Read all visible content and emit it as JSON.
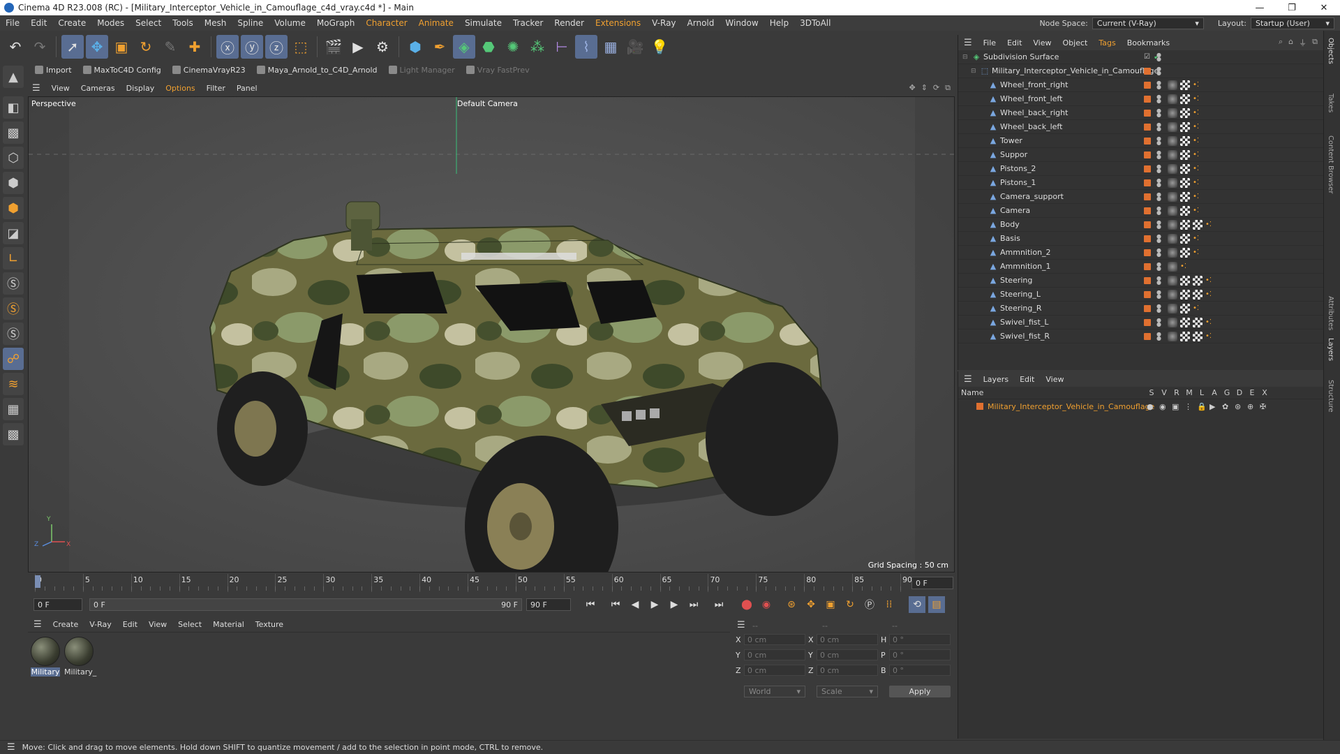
{
  "window": {
    "title": "Cinema 4D R23.008 (RC) - [Military_Interceptor_Vehicle_in_Camouflage_c4d_vray.c4d *] - Main",
    "minimize": "—",
    "restore": "❐",
    "close": "✕"
  },
  "menu": [
    "File",
    "Edit",
    "Create",
    "Modes",
    "Select",
    "Tools",
    "Mesh",
    "Spline",
    "Volume",
    "MoGraph",
    "Character",
    "Animate",
    "Simulate",
    "Tracker",
    "Render",
    "Extensions",
    "V-Ray",
    "Arnold",
    "Window",
    "Help",
    "3DToAll"
  ],
  "menu_highlight": [
    "Character",
    "Animate",
    "Extensions"
  ],
  "node_space": {
    "label": "Node Space:",
    "value": "Current (V-Ray)"
  },
  "layout": {
    "label": "Layout:",
    "value": "Startup (User)"
  },
  "toolbar_icons": [
    "undo-icon",
    "redo-icon",
    "live-select-icon",
    "move-icon",
    "scale-icon",
    "rotate-icon",
    "recent-icon",
    "create-icon",
    "x-axis-icon",
    "y-axis-icon",
    "z-axis-icon",
    "coord-system-icon",
    "render-view-icon",
    "render-picture-viewer-icon",
    "render-settings-icon",
    "cube-icon",
    "pen-icon",
    "subdivision-icon",
    "extrude-icon",
    "cloner-icon",
    "array-icon",
    "deformer-icon",
    "spline-icon",
    "floor-icon",
    "camera-icon",
    "light-icon"
  ],
  "plugins": [
    {
      "label": "Import",
      "dim": false
    },
    {
      "label": "MaxToC4D Config",
      "dim": false
    },
    {
      "label": "CinemaVrayR23",
      "dim": false
    },
    {
      "label": "Maya_Arnold_to_C4D_Arnold",
      "dim": false
    },
    {
      "label": "Light Manager",
      "dim": true
    },
    {
      "label": "Vray FastPrev",
      "dim": true
    }
  ],
  "viewport": {
    "menu": [
      "View",
      "Cameras",
      "Display",
      "Options",
      "Filter",
      "Panel"
    ],
    "menu_highlight": "Options",
    "name": "Perspective",
    "camera": "Default Camera",
    "grid_spacing": "Grid Spacing : 50 cm",
    "axis": {
      "y": "Y",
      "z": "Z",
      "x": "X"
    }
  },
  "timeline": {
    "ticks": [
      "0",
      "5",
      "10",
      "15",
      "20",
      "25",
      "30",
      "35",
      "40",
      "45",
      "50",
      "55",
      "60",
      "65",
      "70",
      "75",
      "80",
      "85",
      "90"
    ],
    "current_frame": "0 F"
  },
  "transport": {
    "start": "0 F",
    "current": "0 F",
    "end_inner": "90 F",
    "end": "90 F"
  },
  "material_menu": [
    "Create",
    "V-Ray",
    "Edit",
    "View",
    "Select",
    "Material",
    "Texture"
  ],
  "materials": [
    {
      "name": "Military",
      "selected": true
    },
    {
      "name": "Military_",
      "selected": false
    }
  ],
  "coords": {
    "header": [
      "--",
      "--",
      "--"
    ],
    "rows": [
      {
        "a": "X",
        "av": "0 cm",
        "b": "X",
        "bv": "0 cm",
        "c": "H",
        "cv": "0 °"
      },
      {
        "a": "Y",
        "av": "0 cm",
        "b": "Y",
        "bv": "0 cm",
        "c": "P",
        "cv": "0 °"
      },
      {
        "a": "Z",
        "av": "0 cm",
        "b": "Z",
        "bv": "0 cm",
        "c": "B",
        "cv": "0 °"
      }
    ],
    "space": "World",
    "mode": "Scale",
    "apply": "Apply"
  },
  "status": "Move: Click and drag to move elements. Hold down SHIFT to quantize movement / add to the selection in point mode, CTRL to remove.",
  "objects_menu": [
    "File",
    "Edit",
    "View",
    "Object",
    "Tags",
    "Bookmarks"
  ],
  "objects_menu_highlight": "Tags",
  "objects": [
    {
      "name": "Subdivision Surface",
      "level": 0,
      "kind": "subdiv"
    },
    {
      "name": "Military_Interceptor_Vehicle_in_Camouflage",
      "level": 1,
      "kind": "null"
    },
    {
      "name": "Wheel_front_right",
      "level": 2,
      "kind": "poly",
      "tags": 3
    },
    {
      "name": "Wheel_front_left",
      "level": 2,
      "kind": "poly",
      "tags": 3
    },
    {
      "name": "Wheel_back_right",
      "level": 2,
      "kind": "poly",
      "tags": 3
    },
    {
      "name": "Wheel_back_left",
      "level": 2,
      "kind": "poly",
      "tags": 3
    },
    {
      "name": "Tower",
      "level": 2,
      "kind": "poly",
      "tags": 3
    },
    {
      "name": "Suppor",
      "level": 2,
      "kind": "poly",
      "tags": 3
    },
    {
      "name": "Pistons_2",
      "level": 2,
      "kind": "poly",
      "tags": 3
    },
    {
      "name": "Pistons_1",
      "level": 2,
      "kind": "poly",
      "tags": 3
    },
    {
      "name": "Camera_support",
      "level": 2,
      "kind": "poly",
      "tags": 3
    },
    {
      "name": "Camera",
      "level": 2,
      "kind": "poly",
      "tags": 3
    },
    {
      "name": "Body",
      "level": 2,
      "kind": "poly",
      "tags": 4
    },
    {
      "name": "Basis",
      "level": 2,
      "kind": "poly",
      "tags": 3
    },
    {
      "name": "Ammnition_2",
      "level": 2,
      "kind": "poly",
      "tags": 3
    },
    {
      "name": "Ammnition_1",
      "level": 2,
      "kind": "poly",
      "tags": 2
    },
    {
      "name": "Steering",
      "level": 2,
      "kind": "poly",
      "tags": 4
    },
    {
      "name": "Steering_L",
      "level": 2,
      "kind": "poly",
      "tags": 4
    },
    {
      "name": "Steering_R",
      "level": 2,
      "kind": "poly",
      "tags": 3
    },
    {
      "name": "Swivel_fist_L",
      "level": 2,
      "kind": "poly",
      "tags": 4
    },
    {
      "name": "Swivel_fist_R",
      "level": 2,
      "kind": "poly",
      "tags": 4
    }
  ],
  "layers_menu": [
    "Layers",
    "Edit",
    "View"
  ],
  "layer_header": {
    "name": "Name",
    "cols": [
      "S",
      "V",
      "R",
      "M",
      "L",
      "A",
      "G",
      "D",
      "E",
      "X"
    ]
  },
  "layers": [
    {
      "name": "Military_Interceptor_Vehicle_in_Camouflage",
      "color": "#e07030"
    }
  ],
  "side_tabs": [
    "Objects",
    "Takes",
    "Content Browser",
    "Attributes",
    "Layers",
    "Structure"
  ],
  "colors": {
    "accent": "#f0a030",
    "selection": "#596d92",
    "layer_orange": "#e07030"
  }
}
